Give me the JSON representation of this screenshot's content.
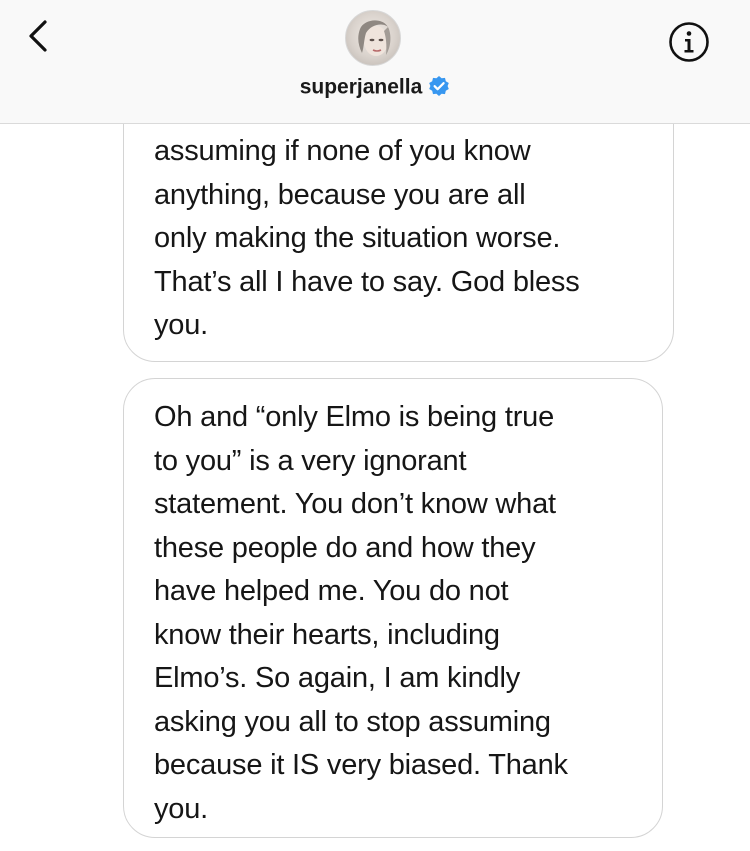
{
  "header": {
    "username": "superjanella",
    "back_icon": "chevron-left-icon",
    "info_icon": "info-icon",
    "verified_icon": "verified-badge-icon",
    "verified_color": "#3897f0"
  },
  "messages": [
    {
      "lines": [
        "assuming if none of you know",
        "anything, because you are all",
        "only making the situation worse.",
        "That’s all I have to say. God bless",
        "you."
      ]
    },
    {
      "lines": [
        "Oh and “only Elmo is being true",
        "to you” is a very ignorant",
        "statement. You don’t know what",
        "these people do and how they",
        "have helped me. You do not",
        "know their hearts, including",
        "Elmo’s. So again, I am kindly",
        "asking you all to stop assuming",
        "because it IS very biased. Thank",
        "you."
      ]
    }
  ]
}
